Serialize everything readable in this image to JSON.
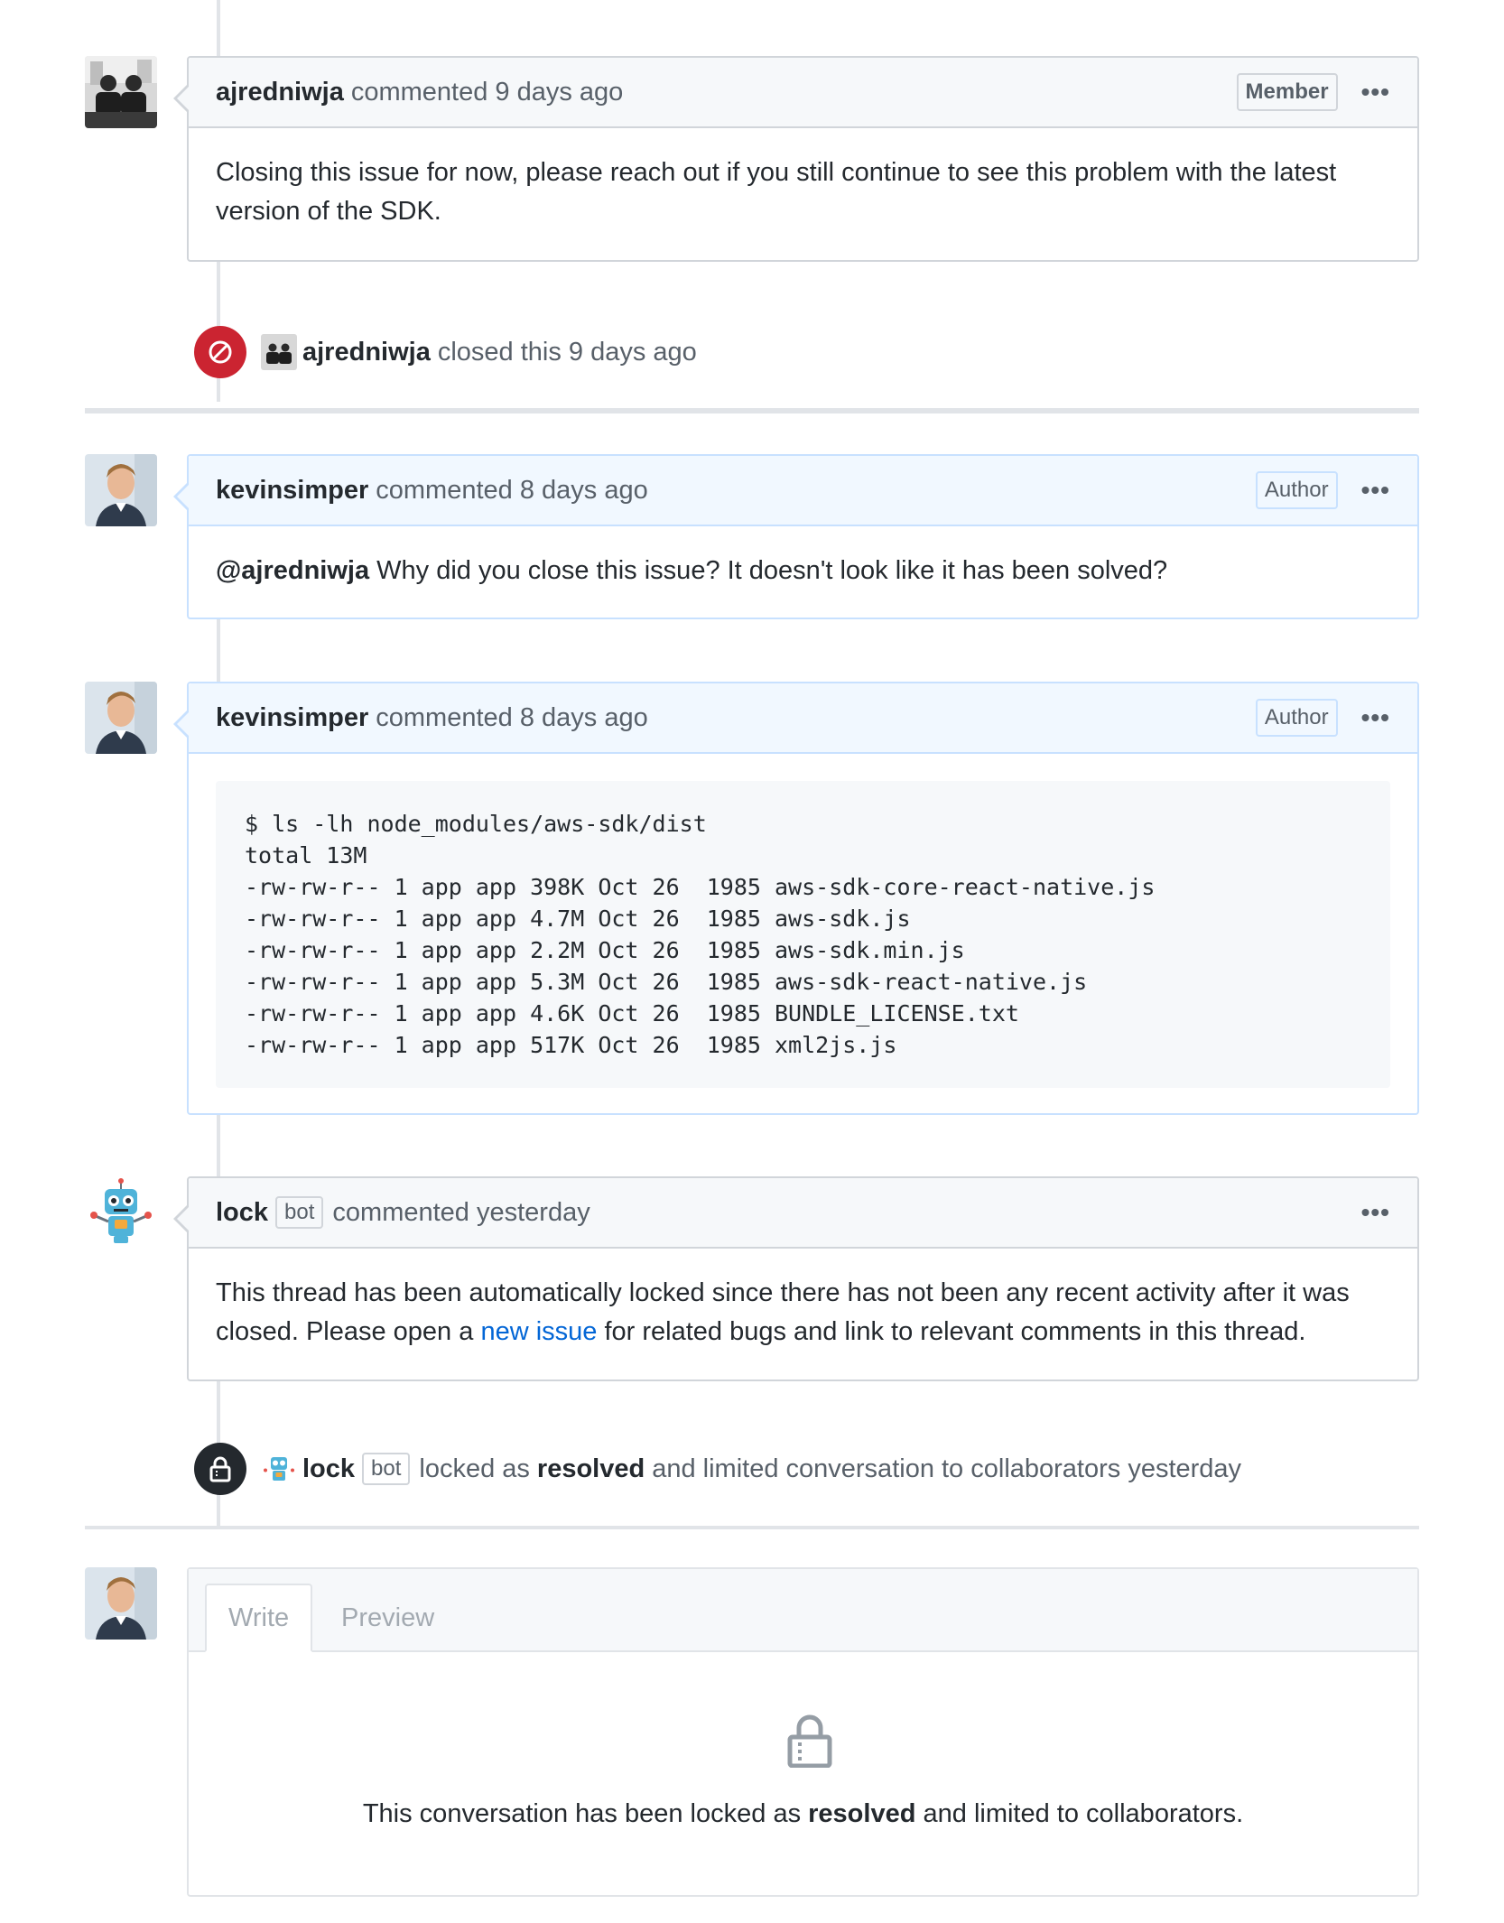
{
  "comments": [
    {
      "user": "ajredniwja",
      "meta": "commented 9 days ago",
      "badge": "Member",
      "kebab": "•••",
      "body": "Closing this issue for now, please reach out if you still continue to see this problem with the latest version of the SDK."
    },
    {
      "user": "kevinsimper",
      "meta": "commented 8 days ago",
      "badge": "Author",
      "kebab": "•••",
      "mention": "@ajredniwja",
      "body": "Why did you close this issue? It doesn't look like it has been solved?"
    },
    {
      "user": "kevinsimper",
      "meta": "commented 8 days ago",
      "badge": "Author",
      "kebab": "•••",
      "code": "$ ls -lh node_modules/aws-sdk/dist\ntotal 13M\n-rw-rw-r-- 1 app app 398K Oct 26  1985 aws-sdk-core-react-native.js\n-rw-rw-r-- 1 app app 4.7M Oct 26  1985 aws-sdk.js\n-rw-rw-r-- 1 app app 2.2M Oct 26  1985 aws-sdk.min.js\n-rw-rw-r-- 1 app app 5.3M Oct 26  1985 aws-sdk-react-native.js\n-rw-rw-r-- 1 app app 4.6K Oct 26  1985 BUNDLE_LICENSE.txt\n-rw-rw-r-- 1 app app 517K Oct 26  1985 xml2js.js"
    },
    {
      "user": "lock",
      "bot_label": "bot",
      "meta": "commented yesterday",
      "kebab": "•••",
      "body_before_link": "This thread has been automatically locked since there has not been any recent activity after it was closed. Please open a",
      "link_text": "new issue",
      "body_after_link": "for related bugs and link to relevant comments in this thread."
    }
  ],
  "events": {
    "closed": {
      "user": "ajredniwja",
      "text": "closed this 9 days ago"
    },
    "locked": {
      "user": "lock",
      "bot_label": "bot",
      "text_before": "locked as",
      "strong": "resolved",
      "text_after": "and limited conversation to collaborators yesterday"
    }
  },
  "editor": {
    "tab_write": "Write",
    "tab_preview": "Preview",
    "msg_before": "This conversation has been locked as",
    "msg_strong": "resolved",
    "msg_after": "and limited to collaborators."
  },
  "colors": {
    "closed_badge": "#cb2431",
    "locked_badge": "#24292e",
    "link": "#0366d6",
    "author_border": "#c8e1ff"
  }
}
